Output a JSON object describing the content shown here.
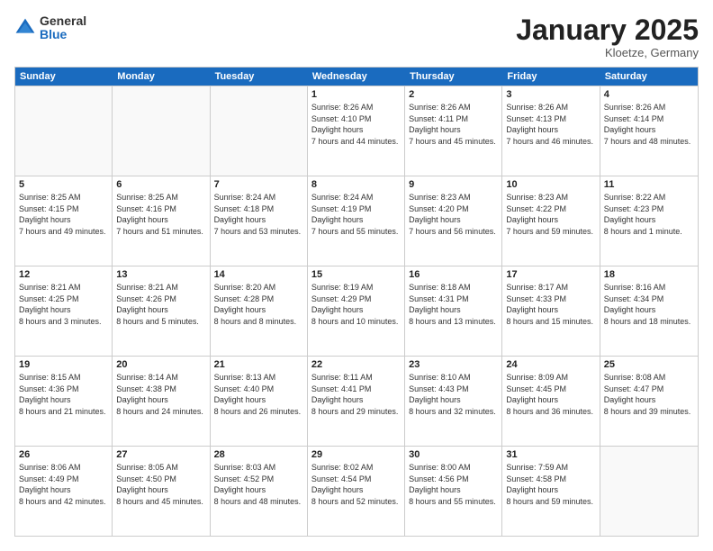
{
  "logo": {
    "general": "General",
    "blue": "Blue"
  },
  "header": {
    "month": "January 2025",
    "location": "Kloetze, Germany"
  },
  "weekdays": [
    "Sunday",
    "Monday",
    "Tuesday",
    "Wednesday",
    "Thursday",
    "Friday",
    "Saturday"
  ],
  "weeks": [
    [
      {
        "day": "",
        "empty": true
      },
      {
        "day": "",
        "empty": true
      },
      {
        "day": "",
        "empty": true
      },
      {
        "day": "1",
        "sunrise": "8:26 AM",
        "sunset": "4:10 PM",
        "daylight": "7 hours and 44 minutes."
      },
      {
        "day": "2",
        "sunrise": "8:26 AM",
        "sunset": "4:11 PM",
        "daylight": "7 hours and 45 minutes."
      },
      {
        "day": "3",
        "sunrise": "8:26 AM",
        "sunset": "4:13 PM",
        "daylight": "7 hours and 46 minutes."
      },
      {
        "day": "4",
        "sunrise": "8:26 AM",
        "sunset": "4:14 PM",
        "daylight": "7 hours and 48 minutes."
      }
    ],
    [
      {
        "day": "5",
        "sunrise": "8:25 AM",
        "sunset": "4:15 PM",
        "daylight": "7 hours and 49 minutes."
      },
      {
        "day": "6",
        "sunrise": "8:25 AM",
        "sunset": "4:16 PM",
        "daylight": "7 hours and 51 minutes."
      },
      {
        "day": "7",
        "sunrise": "8:24 AM",
        "sunset": "4:18 PM",
        "daylight": "7 hours and 53 minutes."
      },
      {
        "day": "8",
        "sunrise": "8:24 AM",
        "sunset": "4:19 PM",
        "daylight": "7 hours and 55 minutes."
      },
      {
        "day": "9",
        "sunrise": "8:23 AM",
        "sunset": "4:20 PM",
        "daylight": "7 hours and 56 minutes."
      },
      {
        "day": "10",
        "sunrise": "8:23 AM",
        "sunset": "4:22 PM",
        "daylight": "7 hours and 59 minutes."
      },
      {
        "day": "11",
        "sunrise": "8:22 AM",
        "sunset": "4:23 PM",
        "daylight": "8 hours and 1 minute."
      }
    ],
    [
      {
        "day": "12",
        "sunrise": "8:21 AM",
        "sunset": "4:25 PM",
        "daylight": "8 hours and 3 minutes."
      },
      {
        "day": "13",
        "sunrise": "8:21 AM",
        "sunset": "4:26 PM",
        "daylight": "8 hours and 5 minutes."
      },
      {
        "day": "14",
        "sunrise": "8:20 AM",
        "sunset": "4:28 PM",
        "daylight": "8 hours and 8 minutes."
      },
      {
        "day": "15",
        "sunrise": "8:19 AM",
        "sunset": "4:29 PM",
        "daylight": "8 hours and 10 minutes."
      },
      {
        "day": "16",
        "sunrise": "8:18 AM",
        "sunset": "4:31 PM",
        "daylight": "8 hours and 13 minutes."
      },
      {
        "day": "17",
        "sunrise": "8:17 AM",
        "sunset": "4:33 PM",
        "daylight": "8 hours and 15 minutes."
      },
      {
        "day": "18",
        "sunrise": "8:16 AM",
        "sunset": "4:34 PM",
        "daylight": "8 hours and 18 minutes."
      }
    ],
    [
      {
        "day": "19",
        "sunrise": "8:15 AM",
        "sunset": "4:36 PM",
        "daylight": "8 hours and 21 minutes."
      },
      {
        "day": "20",
        "sunrise": "8:14 AM",
        "sunset": "4:38 PM",
        "daylight": "8 hours and 24 minutes."
      },
      {
        "day": "21",
        "sunrise": "8:13 AM",
        "sunset": "4:40 PM",
        "daylight": "8 hours and 26 minutes."
      },
      {
        "day": "22",
        "sunrise": "8:11 AM",
        "sunset": "4:41 PM",
        "daylight": "8 hours and 29 minutes."
      },
      {
        "day": "23",
        "sunrise": "8:10 AM",
        "sunset": "4:43 PM",
        "daylight": "8 hours and 32 minutes."
      },
      {
        "day": "24",
        "sunrise": "8:09 AM",
        "sunset": "4:45 PM",
        "daylight": "8 hours and 36 minutes."
      },
      {
        "day": "25",
        "sunrise": "8:08 AM",
        "sunset": "4:47 PM",
        "daylight": "8 hours and 39 minutes."
      }
    ],
    [
      {
        "day": "26",
        "sunrise": "8:06 AM",
        "sunset": "4:49 PM",
        "daylight": "8 hours and 42 minutes."
      },
      {
        "day": "27",
        "sunrise": "8:05 AM",
        "sunset": "4:50 PM",
        "daylight": "8 hours and 45 minutes."
      },
      {
        "day": "28",
        "sunrise": "8:03 AM",
        "sunset": "4:52 PM",
        "daylight": "8 hours and 48 minutes."
      },
      {
        "day": "29",
        "sunrise": "8:02 AM",
        "sunset": "4:54 PM",
        "daylight": "8 hours and 52 minutes."
      },
      {
        "day": "30",
        "sunrise": "8:00 AM",
        "sunset": "4:56 PM",
        "daylight": "8 hours and 55 minutes."
      },
      {
        "day": "31",
        "sunrise": "7:59 AM",
        "sunset": "4:58 PM",
        "daylight": "8 hours and 59 minutes."
      },
      {
        "day": "",
        "empty": true
      }
    ]
  ],
  "labels": {
    "sunrise": "Sunrise:",
    "sunset": "Sunset:",
    "daylight": "Daylight hours"
  }
}
